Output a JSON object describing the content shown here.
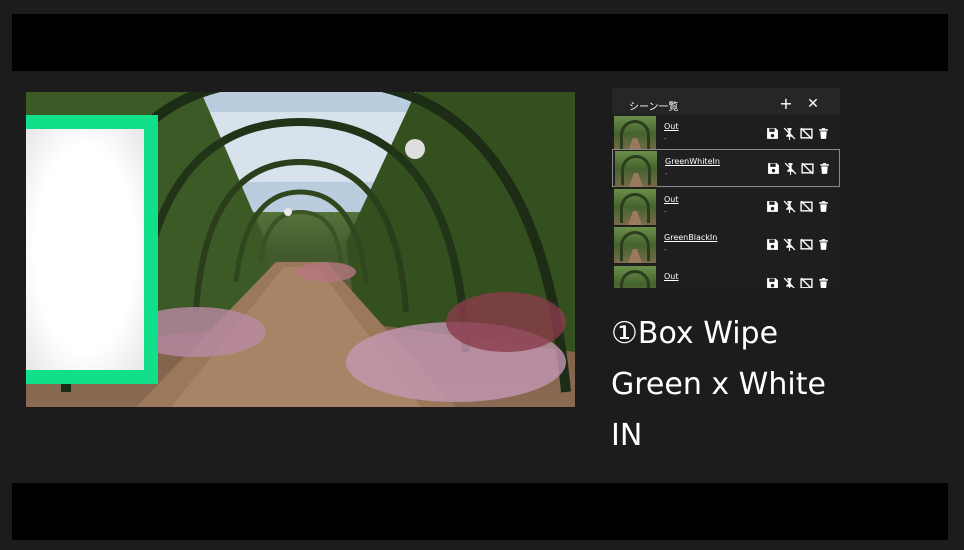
{
  "panel": {
    "title": "シーン一覧",
    "add_label": "+",
    "close_label": "✕",
    "rows": [
      {
        "name": "Out",
        "sub": "-"
      },
      {
        "name": "GreenWhiteIn",
        "sub": "-"
      },
      {
        "name": "Out",
        "sub": "-"
      },
      {
        "name": "GreenBlackIn",
        "sub": "-"
      },
      {
        "name": "Out",
        "sub": "-"
      }
    ]
  },
  "caption": {
    "line1": "①Box Wipe",
    "line2": "Green x White",
    "line3": "IN"
  },
  "colors": {
    "wipe_border": "#12df8a",
    "background": "#1c1c1c",
    "letterbox": "#000000"
  },
  "icons": [
    "save-icon",
    "unpin-icon",
    "hide-icon",
    "delete-icon"
  ]
}
